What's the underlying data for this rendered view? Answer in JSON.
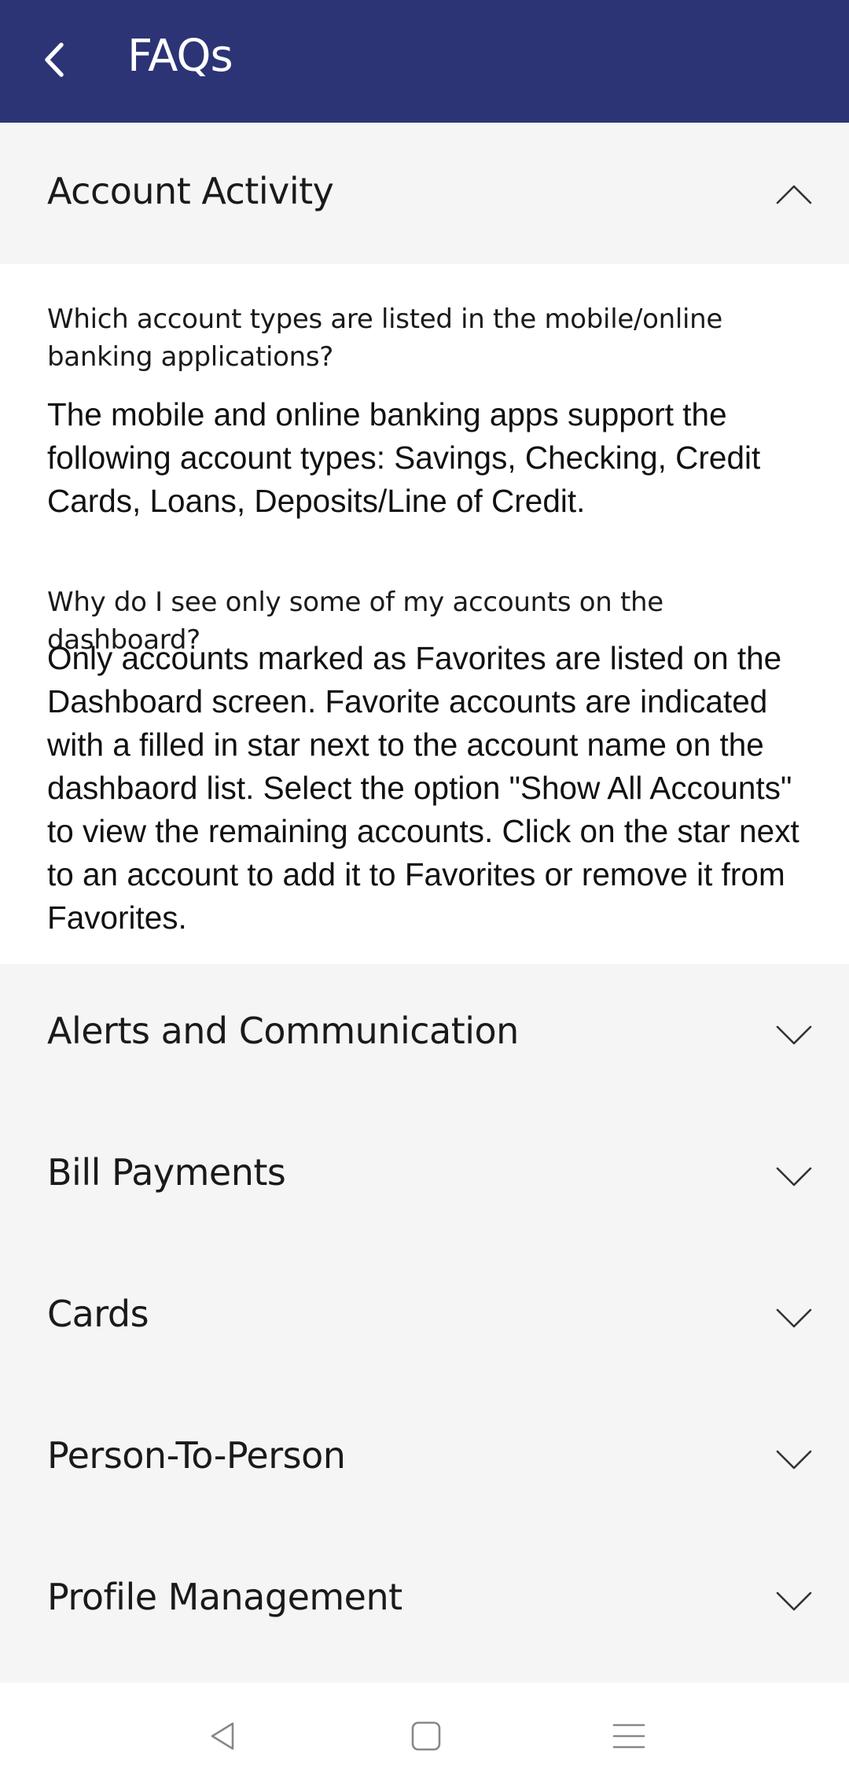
{
  "header": {
    "title": "FAQs",
    "back_icon": "chevron-left-icon",
    "background": "#2c3476"
  },
  "sections": [
    {
      "title": "Account Activity",
      "expanded": true,
      "faqs": [
        {
          "question": "Which account types are listed in the mobile/online banking applications?",
          "answer": "The mobile and online banking apps support the following account types: Savings, Checking, Credit Cards, Loans, Deposits/Line of Credit."
        },
        {
          "question": "Why do I see only some of my accounts on the dashboard?",
          "answer": "Only accounts marked as Favorites are listed on the Dashboard screen. Favorite accounts are indicated with a filled in star next to the account name on the dashbaord list. Select the option \"Show All Accounts\" to view the remaining accounts. Click on the star next to an account to add it to Favorites or remove it from Favorites."
        }
      ]
    },
    {
      "title": "Alerts and Communication",
      "expanded": false
    },
    {
      "title": "Bill Payments",
      "expanded": false
    },
    {
      "title": "Cards",
      "expanded": false
    },
    {
      "title": "Person-To-Person",
      "expanded": false
    },
    {
      "title": "Profile Management",
      "expanded": false
    }
  ],
  "nav_bar": {
    "back_icon": "triangle-back-icon",
    "home_icon": "square-home-icon",
    "menu_icon": "hamburger-menu-icon"
  }
}
